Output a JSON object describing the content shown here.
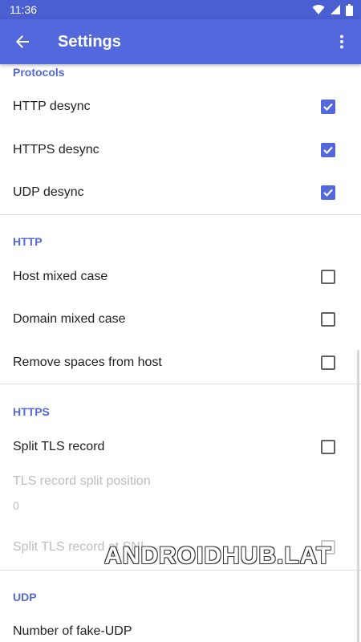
{
  "status_bar": {
    "time": "11:36",
    "icons": [
      "wifi-icon",
      "signal-icon",
      "battery-icon"
    ]
  },
  "app_bar": {
    "title": "Settings",
    "back_icon": "arrow-back-icon",
    "menu_icon": "more-vert-icon"
  },
  "colors": {
    "primary": "#5468de",
    "status_bar": "#4a5fd1",
    "text": "#212121",
    "disabled": "#bdbdbd",
    "divider": "#e0e0e0"
  },
  "sections": {
    "protocols": {
      "title": "Protocols",
      "items": [
        {
          "label": "HTTP desync",
          "checked": true,
          "enabled": true
        },
        {
          "label": "HTTPS desync",
          "checked": true,
          "enabled": true
        },
        {
          "label": "UDP desync",
          "checked": true,
          "enabled": true
        }
      ]
    },
    "http": {
      "title": "HTTP",
      "items": [
        {
          "label": "Host mixed case",
          "checked": false,
          "enabled": true
        },
        {
          "label": "Domain mixed case",
          "checked": false,
          "enabled": true
        },
        {
          "label": "Remove spaces from host",
          "checked": false,
          "enabled": true
        }
      ]
    },
    "https": {
      "title": "HTTPS",
      "items": [
        {
          "label": "Split TLS record",
          "checked": false,
          "enabled": true
        },
        {
          "label": "TLS record split position",
          "summary": "0",
          "enabled": false
        },
        {
          "label": "Split TLS record at SNI",
          "checked": false,
          "enabled": false
        }
      ]
    },
    "udp": {
      "title": "UDP",
      "items": [
        {
          "label": "Number of fake-UDP",
          "enabled": true
        }
      ]
    }
  },
  "watermark": "ANDROIDHUB.LAT"
}
